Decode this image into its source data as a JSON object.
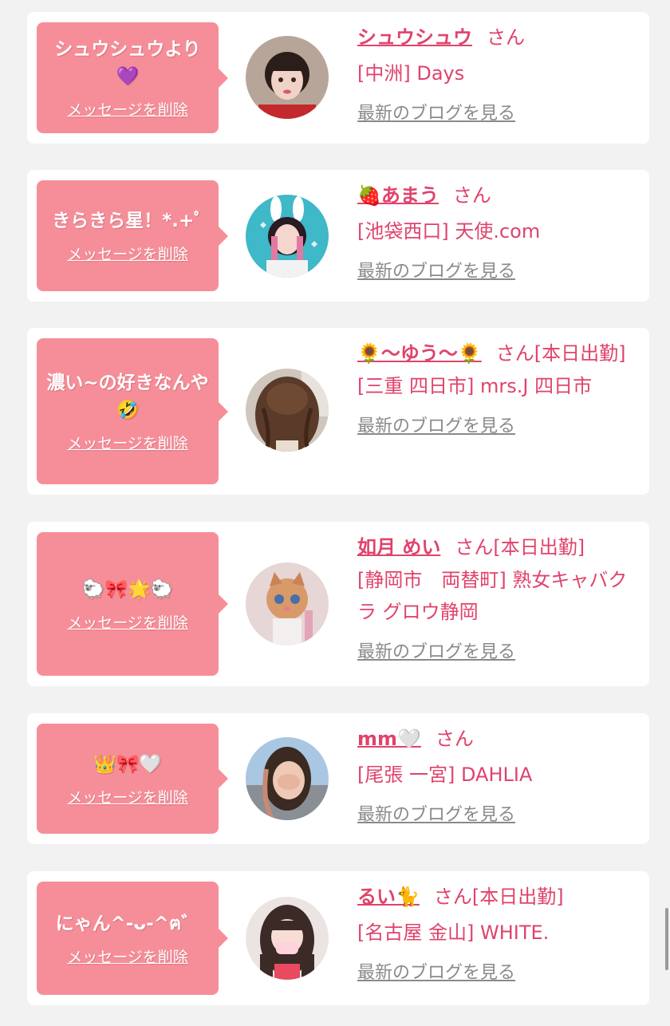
{
  "cards": [
    {
      "message": "シュウシュウより💜",
      "delete_label": "メッセージを削除",
      "name": "シュウシュウ",
      "suffix": "さん",
      "shop": "[中洲] Days",
      "blog_label": "最新のブログを見る"
    },
    {
      "message": "きらきら星！*.+ﾟ",
      "delete_label": "メッセージを削除",
      "name": "🍓あまう",
      "suffix": "さん",
      "shop": "[池袋西口] 天使.com",
      "blog_label": "最新のブログを見る"
    },
    {
      "message": "濃い~の好きなんや🤣",
      "delete_label": "メッセージを削除",
      "name": "🌻〜ゆう〜🌻",
      "suffix": "さん[本日出勤]",
      "shop": "[三重 四日市] mrs.J 四日市",
      "blog_label": "最新のブログを見る"
    },
    {
      "message": "🐑🎀🌟🐑",
      "delete_label": "メッセージを削除",
      "name": "如月 めい",
      "suffix": "さん[本日出勤]",
      "shop": "[静岡市　両替町] 熟女キャバクラ グロウ静岡",
      "blog_label": "最新のブログを見る"
    },
    {
      "message": "👑🎀🤍",
      "delete_label": "メッセージを削除",
      "name": "mm🤍",
      "suffix": "さん",
      "shop": "[尾張 一宮] DAHLIA",
      "blog_label": "最新のブログを見る"
    },
    {
      "message": "にゃん^-ᴗ-^ฅ゛",
      "delete_label": "メッセージを削除",
      "name": "るい🐈",
      "suffix": "さん[本日出勤]",
      "shop": "[名古屋 金山] WHITE.",
      "blog_label": "最新のブログを見る"
    }
  ],
  "colors": {
    "accent": "#e0436b",
    "bubble": "#f68e99",
    "background": "#f2f2f2",
    "link_gray": "#8a8a8a"
  }
}
